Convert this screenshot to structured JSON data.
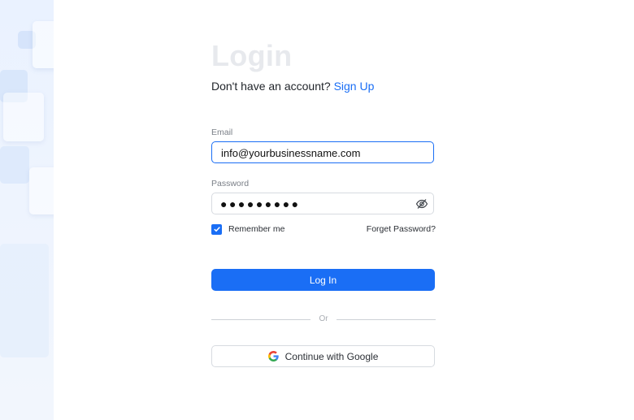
{
  "login": {
    "title": "Login",
    "signup_prompt": "Don't have an account?",
    "signup_link": "Sign Up",
    "email_label": "Email",
    "email_value": "info@yourbusinessname.com",
    "password_label": "Password",
    "password_mask": "●●●●●●●●●",
    "remember_label": "Remember me",
    "remember_checked": true,
    "forgot_label": "Forget Password?",
    "login_button": "Log In",
    "divider_text": "Or",
    "google_button": "Continue with Google",
    "icons": {
      "password_toggle": "eye-slash-icon",
      "checkbox": "check-icon",
      "google": "google-logo-icon"
    },
    "colors": {
      "accent": "#1a6ef5",
      "title": "#e7e9ed"
    }
  }
}
